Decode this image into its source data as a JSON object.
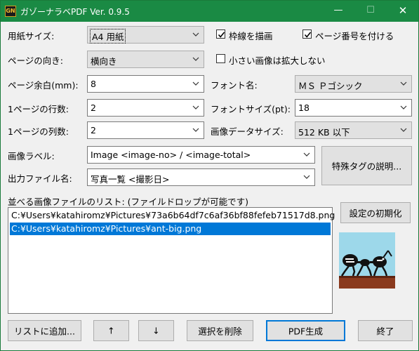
{
  "window": {
    "title": "ガゾーナラベPDF Ver. 0.9.5",
    "icon_text": "GN",
    "minimize": "—",
    "maximize": "☐",
    "close": "✕"
  },
  "form": {
    "paper_size": {
      "label": "用紙サイズ:",
      "value": "A4 用紙"
    },
    "orientation": {
      "label": "ページの向き:",
      "value": "横向き"
    },
    "margin": {
      "label": "ページ余白(mm):",
      "value": "8"
    },
    "rows": {
      "label": "1ページの行数:",
      "value": "2"
    },
    "cols": {
      "label": "1ページの列数:",
      "value": "2"
    },
    "image_label": {
      "label": "画像ラベル:",
      "value": "Image <image-no> / <image-total>"
    },
    "output_file": {
      "label": "出力ファイル名:",
      "value": "写真一覧 <撮影日>"
    },
    "font_name": {
      "label": "フォント名:",
      "value": "ＭＳ Ｐゴシック"
    },
    "font_size": {
      "label": "フォントサイズ(pt):",
      "value": "18"
    },
    "image_data_size": {
      "label": "画像データサイズ:",
      "value": "512 KB 以下"
    }
  },
  "checkboxes": {
    "draw_border": {
      "label": "枠線を描画",
      "checked": true
    },
    "page_number": {
      "label": "ページ番号を付ける",
      "checked": true
    },
    "no_upscale": {
      "label": "小さい画像は拡大しない",
      "checked": false
    }
  },
  "buttons": {
    "special_tags": "特殊タグの説明...",
    "reset_settings": "設定の初期化",
    "add_to_list": "リストに追加...",
    "move_up": "↑",
    "move_down": "↓",
    "remove_selected": "選択を削除",
    "generate_pdf": "PDF生成",
    "exit": "終了"
  },
  "list": {
    "label": "並べる画像ファイルのリスト: (ファイルドロップが可能です)",
    "items": [
      {
        "path": "C:¥Users¥katahiromz¥Pictures¥73a6b64df7c6af36bf88fefeb71517d8.png",
        "selected": false
      },
      {
        "path": "C:¥Users¥katahiromz¥Pictures¥ant-big.png",
        "selected": true
      }
    ]
  },
  "colors": {
    "titlebar": "#1a8a44",
    "selection": "#0078d7",
    "accent_border": "#0078d7"
  },
  "icons": {
    "dropdown": "chevron-down-icon",
    "check": "check-icon"
  }
}
